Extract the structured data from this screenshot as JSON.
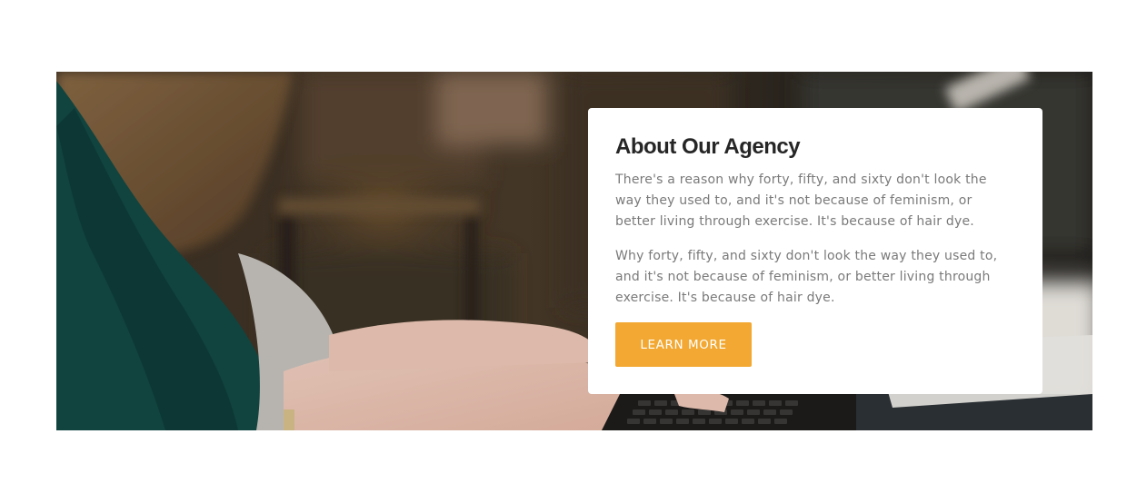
{
  "about": {
    "title": "About Our Agency",
    "paragraphs": [
      "There's a reason why forty, fifty, and sixty don't look the way they used to, and it's not because of feminism, or better living through exercise. It's because of hair dye.",
      "Why forty, fifty, and sixty don't look the way they used to, and it's not because of feminism, or better living through exercise. It's because of hair dye."
    ],
    "button_label": "LEARN MORE"
  },
  "colors": {
    "accent": "#f2a832",
    "title": "#262626",
    "body_text": "#7a7a7a",
    "card_background": "#ffffff"
  }
}
